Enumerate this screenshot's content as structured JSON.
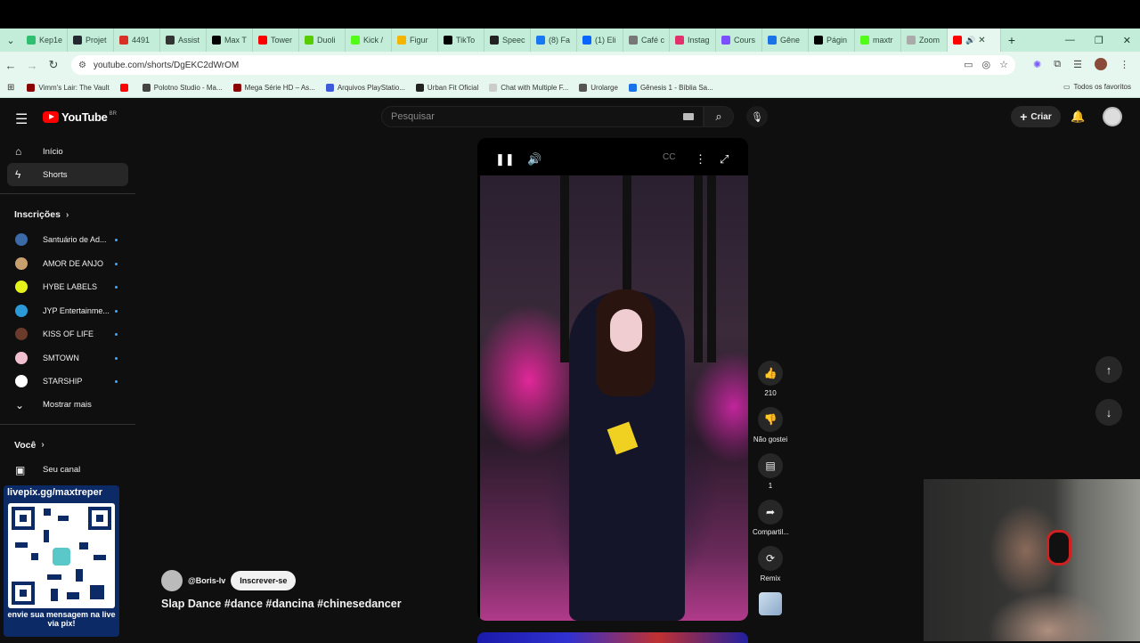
{
  "browser": {
    "tabs": [
      {
        "label": "Kep1e",
        "color": "#2fbf71"
      },
      {
        "label": "Projet",
        "color": "#24292f"
      },
      {
        "label": "4491",
        "color": "#d93025"
      },
      {
        "label": "Assist",
        "color": "#333333"
      },
      {
        "label": "Max T",
        "color": "#000000"
      },
      {
        "label": "Tower",
        "color": "#ff0000"
      },
      {
        "label": "Duoli",
        "color": "#58cc02"
      },
      {
        "label": "Kick /",
        "color": "#53fc18"
      },
      {
        "label": "Figur",
        "color": "#f4b400"
      },
      {
        "label": "TikTo",
        "color": "#000000"
      },
      {
        "label": "Speec",
        "color": "#222222"
      },
      {
        "label": "(8) Fa",
        "color": "#1877f2"
      },
      {
        "label": "(1) Eli",
        "color": "#0866ff"
      },
      {
        "label": "Café c",
        "color": "#777777"
      },
      {
        "label": "Instag",
        "color": "#e1306c"
      },
      {
        "label": "Cours",
        "color": "#7b4fff"
      },
      {
        "label": "Gêne",
        "color": "#1a73e8"
      },
      {
        "label": "Págin",
        "color": "#000000"
      },
      {
        "label": "maxtr",
        "color": "#53fc18"
      },
      {
        "label": "Zoom",
        "color": "#aaaaaa"
      }
    ],
    "url": "youtube.com/shorts/DgEKC2dWrOM",
    "bookmarks": [
      {
        "label": "Vimm's Lair: The Vault",
        "color": "#8b0000"
      },
      {
        "label": "",
        "color": "#ff0000"
      },
      {
        "label": "Polotno Studio - Ma...",
        "color": "#444444"
      },
      {
        "label": "Mega Série HD – As...",
        "color": "#8b0000"
      },
      {
        "label": "Arquivos PlayStatio...",
        "color": "#3b5bdb"
      },
      {
        "label": "Urban Fit Oficial",
        "color": "#222222"
      },
      {
        "label": "Chat with Multiple F...",
        "color": "#cccccc"
      },
      {
        "label": "Urolarge",
        "color": "#555555"
      },
      {
        "label": "Gênesis 1 - Bíblia Sa...",
        "color": "#1a73e8"
      }
    ],
    "all_bookmarks": "Todos os favoritos"
  },
  "youtube": {
    "logo": "YouTube",
    "logo_region": "BR",
    "search_placeholder": "Pesquisar",
    "create_label": "Criar",
    "sidebar": {
      "home": "Início",
      "shorts": "Shorts",
      "subscriptions_heading": "Inscrições",
      "subscriptions": [
        {
          "label": "Santuário de Ad...",
          "color": "#3b6aa8"
        },
        {
          "label": "AMOR DE ANJO",
          "color": "#c8a070"
        },
        {
          "label": "HYBE LABELS",
          "color": "#e4f21a"
        },
        {
          "label": "JYP Entertainme...",
          "color": "#2a9ad8"
        },
        {
          "label": "KISS OF LIFE",
          "color": "#6a3a2a"
        },
        {
          "label": "SMTOWN",
          "color": "#f0c0d0"
        },
        {
          "label": "STARSHIP",
          "color": "#ffffff"
        }
      ],
      "show_more": "Mostrar mais",
      "you_heading": "Você",
      "your_channel": "Seu canal"
    },
    "overlay": {
      "top_text": "livepix.gg/maxtreper",
      "bottom_text": "envie sua mensagem na live via pix!"
    },
    "short": {
      "channel": "@Boris-lv",
      "subscribe": "Inscrever-se",
      "title": "Slap Dance #dance #dancina #chinesedancer",
      "likes": "210",
      "dislike_label": "Não gostei",
      "comments": "1",
      "share_label": "Compartil...",
      "remix_label": "Remix"
    }
  }
}
